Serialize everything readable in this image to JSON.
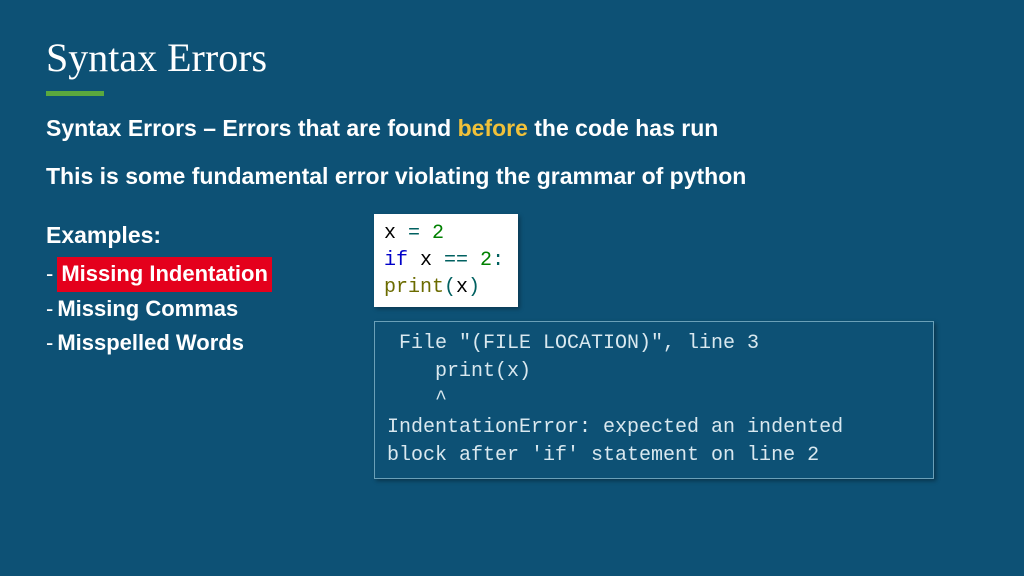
{
  "title": "Syntax Errors",
  "line1": {
    "prefix": "Syntax Errors – Errors that are found ",
    "highlight": "before",
    "suffix": " the code has run"
  },
  "line2": "This is some fundamental error violating the grammar of python",
  "examples": {
    "heading": "Examples:",
    "items": [
      {
        "text": "Missing Indentation",
        "highlighted": true
      },
      {
        "text": "Missing Commas",
        "highlighted": false
      },
      {
        "text": "Misspelled Words",
        "highlighted": false
      }
    ]
  },
  "code": {
    "l1a": "x ",
    "l1b": "= ",
    "l1c": "2",
    "l2a": "if ",
    "l2b": "x ",
    "l2c": "== ",
    "l2d": "2",
    "l2e": ":",
    "l3a": "print",
    "l3b": "(",
    "l3c": "x",
    "l3d": ")"
  },
  "error_output": " File \"(FILE LOCATION)\", line 3\n    print(x)\n    ^\nIndentationError: expected an indented\nblock after 'if' statement on line 2"
}
